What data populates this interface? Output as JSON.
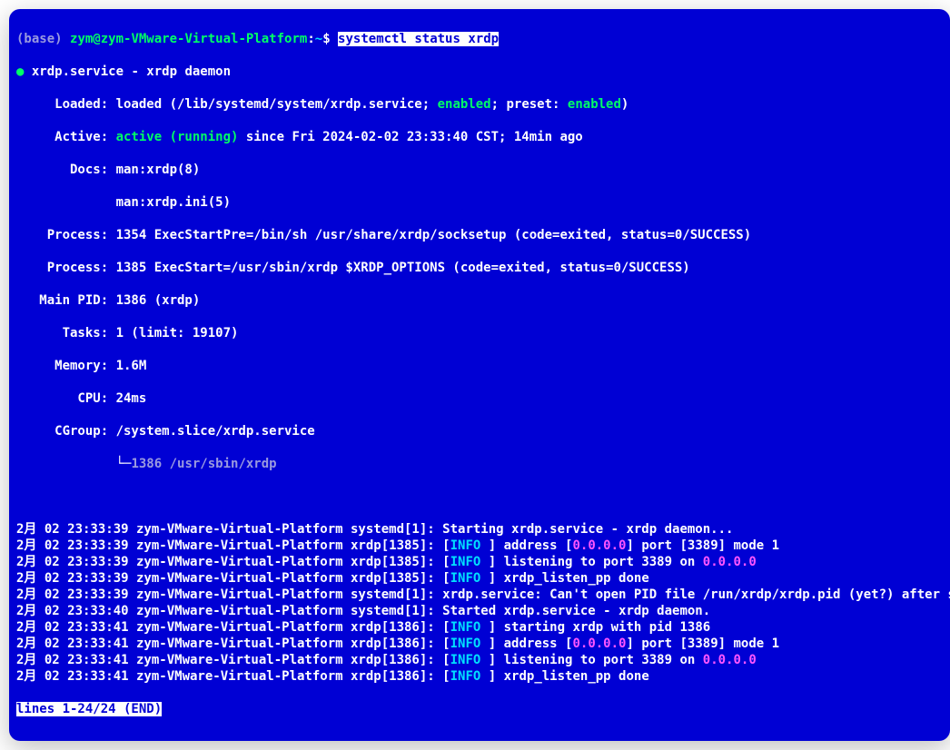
{
  "prompt": {
    "env": "(base) ",
    "userhost": "zym@zym-VMware-Virtual-Platform",
    "sep": ":",
    "path": "~",
    "dollar": "$ ",
    "command": "systemctl status xrdp"
  },
  "header": {
    "bullet": "●",
    "unit_line": " xrdp.service - xrdp daemon",
    "loaded_label": "     Loaded: ",
    "loaded_val1": "loaded (/lib/systemd/system/xrdp.service; ",
    "loaded_enabled1": "enabled",
    "loaded_mid": "; preset: ",
    "loaded_enabled2": "enabled",
    "loaded_end": ")",
    "active_label": "     Active: ",
    "active_state": "active (running)",
    "active_rest": " since Fri 2024-02-02 23:33:40 CST; 14min ago",
    "docs_label": "       Docs: ",
    "docs1": "man:xrdp(8)",
    "docs2": "             man:xrdp.ini(5)",
    "proc1": "    Process: 1354 ExecStartPre=/bin/sh /usr/share/xrdp/socksetup (code=exited, status=0/SUCCESS)",
    "proc2": "    Process: 1385 ExecStart=/usr/sbin/xrdp $XRDP_OPTIONS (code=exited, status=0/SUCCESS)",
    "mainpid": "   Main PID: 1386 (xrdp)",
    "tasks": "      Tasks: 1 (limit: 19107)",
    "memory": "     Memory: 1.6M",
    "cpu": "        CPU: 24ms",
    "cgroup": "     CGroup: /system.slice/xrdp.service",
    "cgroup_child_prefix": "             └─",
    "cgroup_child": "1386 /usr/sbin/xrdp"
  },
  "logs": [
    {
      "ts": "2月 02 23:33:39 zym-VMware-Virtual-Platform systemd[1]: ",
      "msg": "Starting xrdp.service - xrdp daemon..."
    },
    {
      "ts": "2月 02 23:33:39 zym-VMware-Virtual-Platform xrdp[1385]: ",
      "info": true,
      "pre": "[",
      "post": "] address [",
      "ip": "0.0.0.0",
      "tail": "] port [3389] mode 1"
    },
    {
      "ts": "2月 02 23:33:39 zym-VMware-Virtual-Platform xrdp[1385]: ",
      "info": true,
      "pre": "[",
      "post": "] listening to port 3389 on ",
      "ip": "0.0.0.0",
      "tail": ""
    },
    {
      "ts": "2月 02 23:33:39 zym-VMware-Virtual-Platform xrdp[1385]: ",
      "info": true,
      "pre": "[",
      "post": "] xrdp_listen_pp done",
      "ip": "",
      "tail": ""
    },
    {
      "ts": "2月 02 23:33:39 zym-VMware-Virtual-Platform systemd[1]: ",
      "msg": "xrdp.service: Can't open PID file /run/xrdp/xrdp.pid (yet?) after s",
      "arrow": ">"
    },
    {
      "ts": "2月 02 23:33:40 zym-VMware-Virtual-Platform systemd[1]: ",
      "msg": "Started xrdp.service - xrdp daemon."
    },
    {
      "ts": "2月 02 23:33:41 zym-VMware-Virtual-Platform xrdp[1386]: ",
      "info": true,
      "pre": "[",
      "post": "] starting xrdp with pid 1386",
      "ip": "",
      "tail": ""
    },
    {
      "ts": "2月 02 23:33:41 zym-VMware-Virtual-Platform xrdp[1386]: ",
      "info": true,
      "pre": "[",
      "post": "] address [",
      "ip": "0.0.0.0",
      "tail": "] port [3389] mode 1"
    },
    {
      "ts": "2月 02 23:33:41 zym-VMware-Virtual-Platform xrdp[1386]: ",
      "info": true,
      "pre": "[",
      "post": "] listening to port 3389 on ",
      "ip": "0.0.0.0",
      "tail": ""
    },
    {
      "ts": "2月 02 23:33:41 zym-VMware-Virtual-Platform xrdp[1386]: ",
      "info": true,
      "pre": "[",
      "post": "] xrdp_listen_pp done",
      "ip": "",
      "tail": ""
    }
  ],
  "info_tag": "INFO ",
  "pager": "lines 1-24/24 (END)"
}
